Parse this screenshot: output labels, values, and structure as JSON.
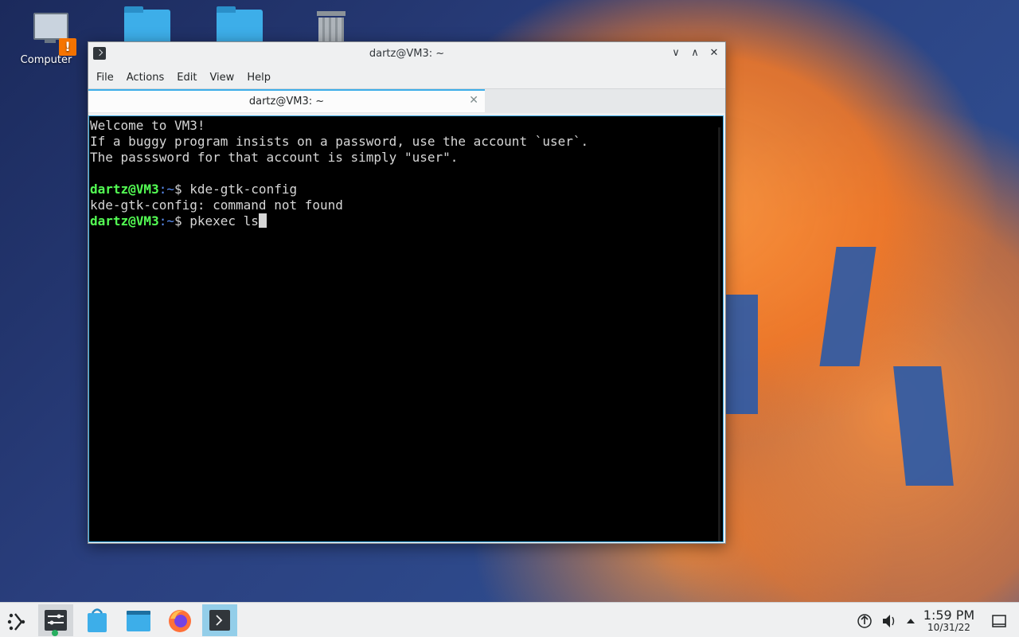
{
  "desktop": {
    "icons": [
      {
        "label": "Computer"
      }
    ]
  },
  "window": {
    "title": "dartz@VM3: ~",
    "controls": {
      "minimize": "∨",
      "maximize": "∧",
      "close": "✕"
    },
    "menu": [
      "File",
      "Actions",
      "Edit",
      "View",
      "Help"
    ],
    "tab": {
      "label": "dartz@VM3: ~",
      "close": "✕"
    }
  },
  "terminal": {
    "lines": [
      "Welcome to VM3!",
      "If a buggy program insists on a password, use the account `user`.",
      "The passsword for that account is simply \"user\"."
    ],
    "prompt_user": "dartz@VM3",
    "prompt_path": ":~",
    "prompt_suffix": "$ ",
    "cmd1": "kde-gtk-config",
    "output1": "kde-gtk-config: command not found",
    "cmd2": "pkexec ls"
  },
  "taskbar": {
    "clock_time": "1:59 PM",
    "clock_date": "10/31/22"
  },
  "colors": {
    "accent": "#3daee9",
    "prompt_user": "#54ff54",
    "prompt_path": "#5c8ff5"
  }
}
